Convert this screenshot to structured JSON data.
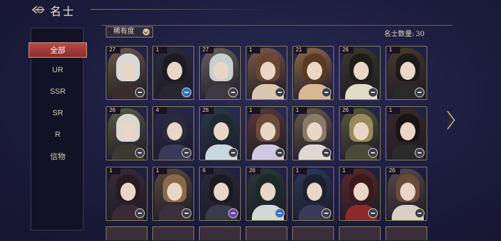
{
  "header": {
    "title": "名士",
    "back_icon": "back-arrow-icon"
  },
  "sidebar": {
    "items": [
      {
        "label": "全部",
        "active": true
      },
      {
        "label": "UR"
      },
      {
        "label": "SSR"
      },
      {
        "label": "SR"
      },
      {
        "label": "R"
      },
      {
        "label": "信物"
      }
    ]
  },
  "filter": {
    "label": "稀有度"
  },
  "count": {
    "label": "名士数量:",
    "value": "30"
  },
  "cards": [
    {
      "level": "27",
      "badge": "grey"
    },
    {
      "level": "1",
      "badge": "blue"
    },
    {
      "level": "27",
      "badge": "grey"
    },
    {
      "level": "1",
      "badge": "grey"
    },
    {
      "level": "21",
      "badge": "grey"
    },
    {
      "level": "26",
      "badge": "grey"
    },
    {
      "level": "1",
      "badge": "grey"
    },
    {
      "level": "26",
      "badge": "grey"
    },
    {
      "level": "4",
      "badge": "grey"
    },
    {
      "level": "26",
      "badge": "grey"
    },
    {
      "level": "1",
      "badge": "grey"
    },
    {
      "level": "1",
      "badge": "grey"
    },
    {
      "level": "26",
      "badge": "grey"
    },
    {
      "level": "1",
      "badge": "grey"
    },
    {
      "level": "1",
      "badge": "grey"
    },
    {
      "level": "1",
      "badge": "grey"
    },
    {
      "level": "6",
      "badge": "purple"
    },
    {
      "level": "26",
      "badge": "blue"
    },
    {
      "level": "1",
      "badge": "grey"
    },
    {
      "level": "1",
      "badge": "grey"
    },
    {
      "level": "26",
      "badge": "grey"
    }
  ]
}
